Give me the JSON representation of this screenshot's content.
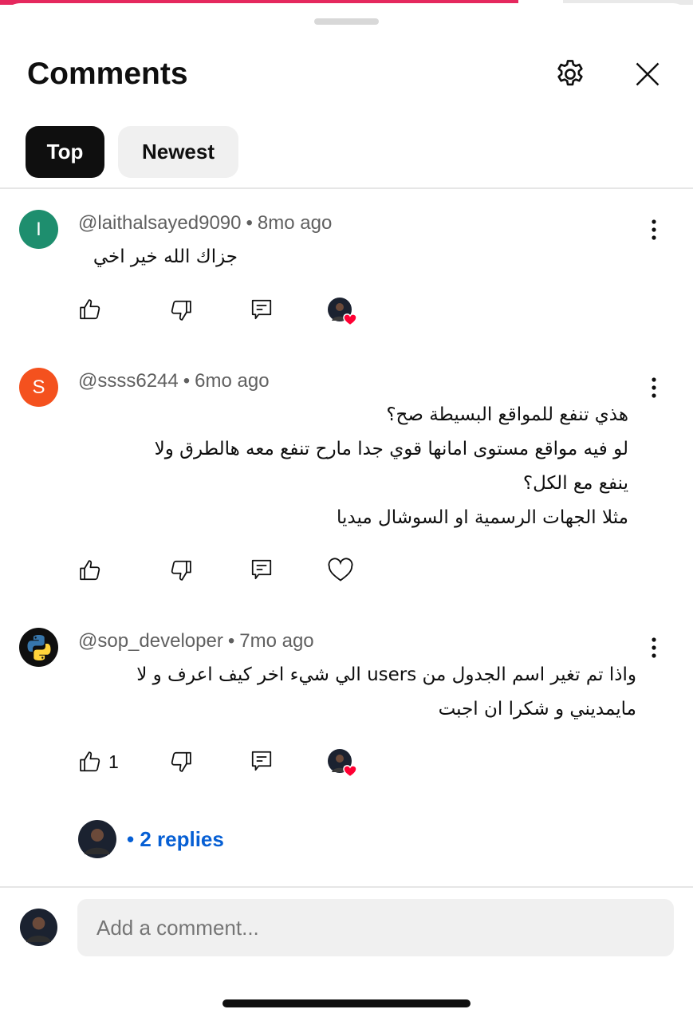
{
  "colors": {
    "progress": "#e5285e",
    "chip_active_bg": "#0f0f0f",
    "link": "#065fd4",
    "like_heart": "#ff0033"
  },
  "video_progress": 0.748,
  "header": {
    "title": "Comments",
    "settings_icon": "gear-icon",
    "close_icon": "close-icon"
  },
  "filters": [
    {
      "label": "Top",
      "active": true
    },
    {
      "label": "Newest",
      "active": false
    }
  ],
  "comments": [
    {
      "avatar_letter": "I",
      "avatar_color": "#1e8e6e",
      "handle": "@laithalsayed9090",
      "time": "8mo ago",
      "text": [
        "جزاك الله خير اخي"
      ],
      "likes": "",
      "creator_hearted": true
    },
    {
      "avatar_letter": "S",
      "avatar_color": "#f4511e",
      "handle": "@ssss6244",
      "time": "6mo ago",
      "text": [
        "هذي تنفع للمواقع البسيطة صح؟",
        "لو فيه مواقع مستوى امانها قوي جدا مارح تنفع معه هالطرق ولا",
        "ينفع مع الكل؟",
        "مثلا الجهات الرسمية او السوشال ميديا"
      ],
      "likes": "",
      "creator_hearted": false
    },
    {
      "avatar_letter": "",
      "avatar_color": "#0f0f0f",
      "handle": "@sop_developer",
      "time": "7mo ago",
      "text": [
        "واذا تم تغير اسم الجدول من users الي شيء اخر كيف اعرف و لا",
        "مايمديني و شكرا ان اجبت"
      ],
      "likes": "1",
      "creator_hearted": true,
      "replies": "• 2 replies"
    }
  ],
  "add_comment": {
    "placeholder": "Add a comment..."
  }
}
